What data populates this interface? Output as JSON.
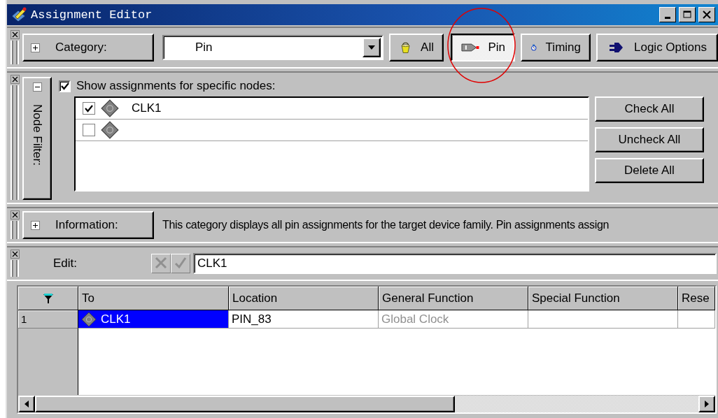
{
  "window": {
    "title": "Assignment Editor"
  },
  "category_bar": {
    "expanded": false,
    "label": "Category:",
    "value": "Pin",
    "buttons": [
      {
        "kind": "bucket",
        "label": "All",
        "selected": false
      },
      {
        "kind": "pin",
        "label": "Pin",
        "selected": true
      },
      {
        "kind": "stopwatch",
        "label": "Timing",
        "selected": false
      },
      {
        "kind": "plug",
        "label": "Logic Options",
        "selected": false
      }
    ]
  },
  "node_filter": {
    "expanded": true,
    "label": "Node Filter:",
    "show_specific": {
      "label": "Show assignments for specific nodes:",
      "checked": true
    },
    "nodes": [
      {
        "name": "CLK1",
        "checked": true
      },
      {
        "checked": false
      }
    ],
    "buttons": [
      "Check All",
      "Uncheck All",
      "Delete All"
    ]
  },
  "information": {
    "expanded": false,
    "label": "Information:",
    "text": "This category displays all pin assignments for the target device family. Pin assignments assign"
  },
  "edit": {
    "label": "Edit:",
    "value": "CLK1"
  },
  "table": {
    "columns": [
      "To",
      "Location",
      "General Function",
      "Special Function",
      "Rese"
    ],
    "rows": [
      {
        "number": "1",
        "cells": [
          {
            "kind": "node",
            "text": "CLK1",
            "selected": true,
            "disabled": false
          },
          {
            "kind": "text",
            "text": "PIN_83",
            "selected": false,
            "disabled": false
          },
          {
            "kind": "text",
            "text": "Global Clock",
            "selected": false,
            "disabled": true
          },
          {
            "kind": "text",
            "selected": false
          },
          {
            "kind": "text",
            "selected": false
          }
        ]
      }
    ]
  }
}
